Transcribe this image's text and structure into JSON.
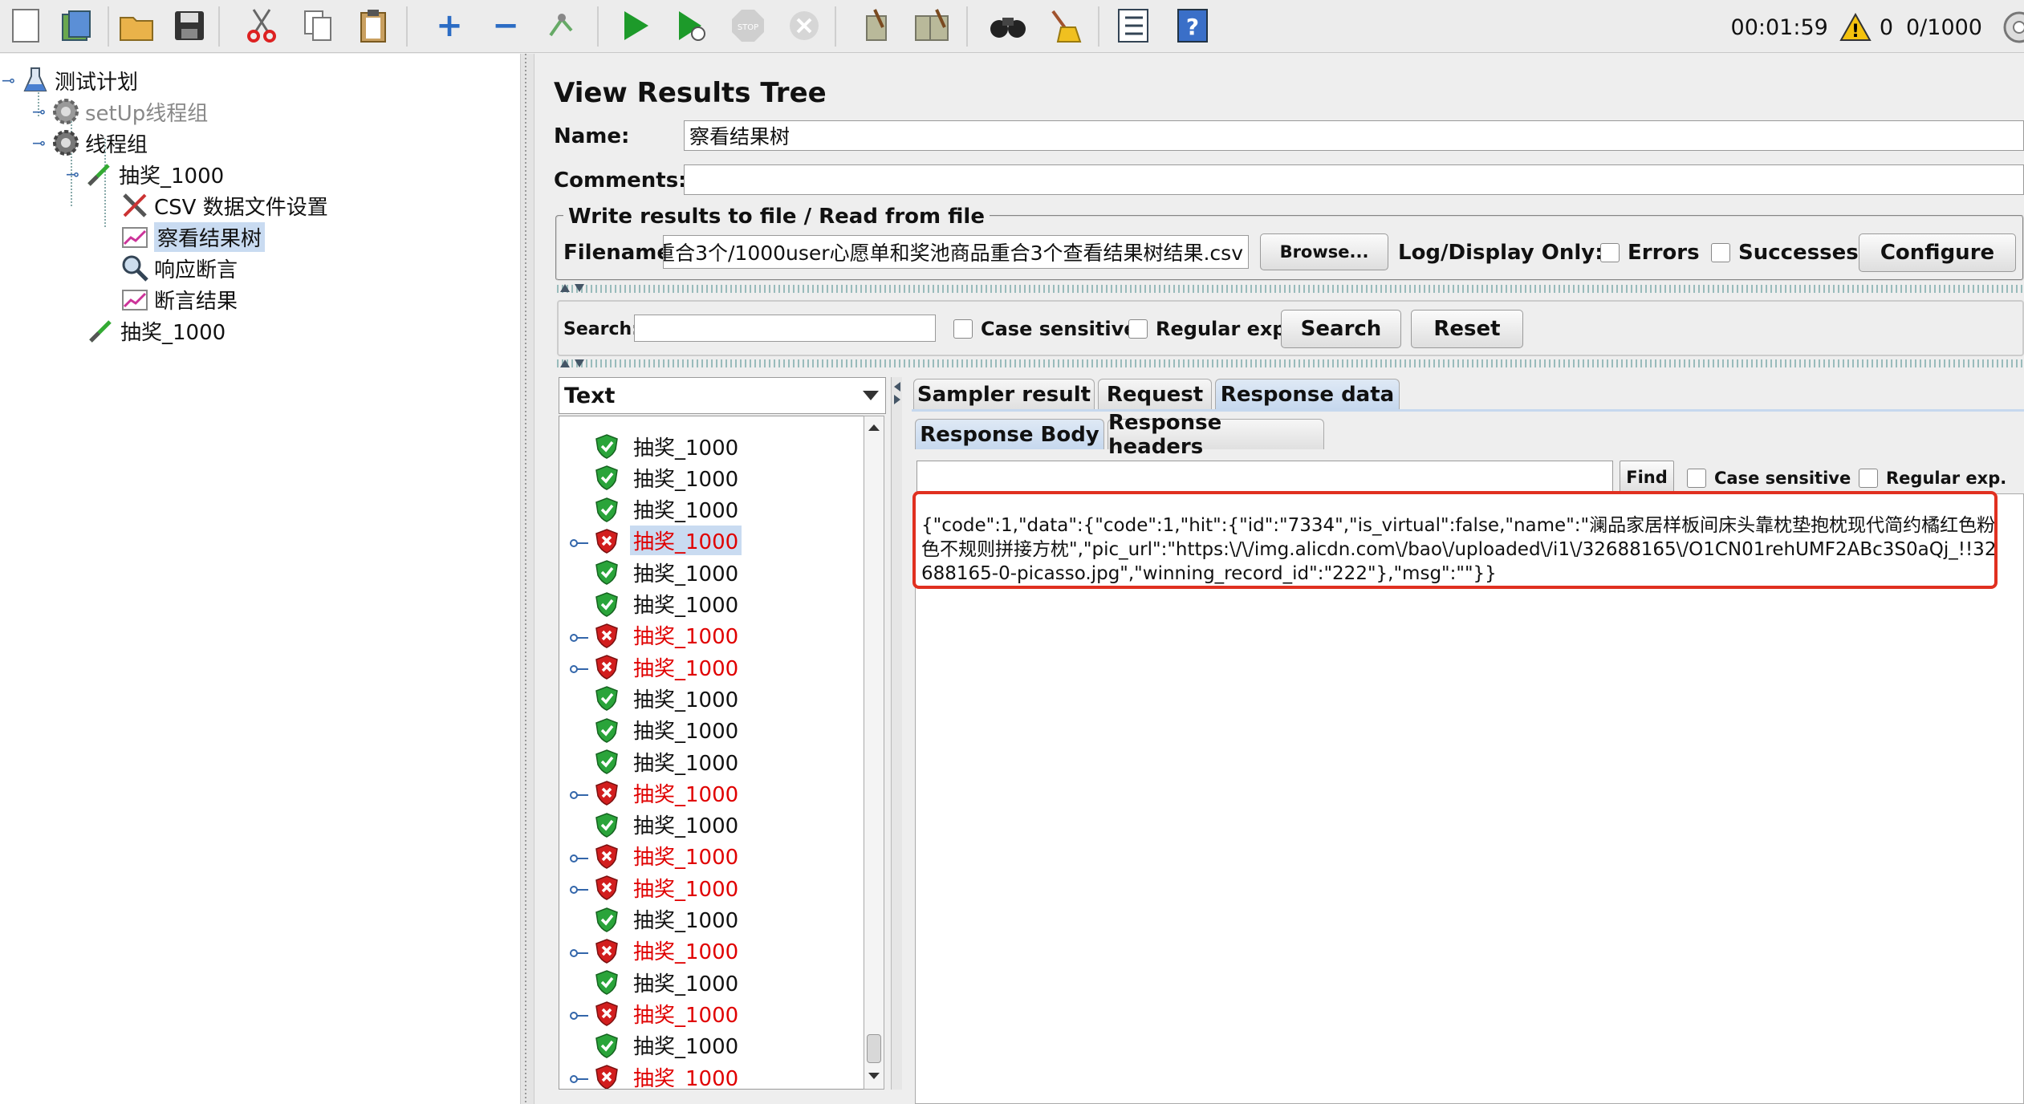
{
  "toolbar": {
    "icons": [
      "new-icon",
      "templates-icon",
      "open-icon",
      "save-icon",
      "cut-icon",
      "copy-icon",
      "paste-icon",
      "expand-icon",
      "collapse-icon",
      "toggle-icon",
      "start-icon",
      "start-no-pause-icon",
      "stop-icon",
      "shutdown-icon",
      "clear-icon",
      "clear-all-icon",
      "search-icon",
      "reset-search-icon",
      "function-helper-icon",
      "help-icon"
    ],
    "elapsed": "00:01:59",
    "warnings": "0",
    "threads": "0/1000"
  },
  "tree": {
    "nodes": [
      {
        "label": "测试计划",
        "icon": "test-plan-icon"
      },
      {
        "label": "setUp线程组",
        "icon": "gear-icon"
      },
      {
        "label": "线程组",
        "icon": "gear-icon"
      },
      {
        "label": "抽奖_1000",
        "icon": "sampler-icon"
      },
      {
        "label": "CSV 数据文件设置",
        "icon": "config-icon"
      },
      {
        "label": "察看结果树",
        "icon": "listener-icon"
      },
      {
        "label": "响应断言",
        "icon": "assertion-icon"
      },
      {
        "label": "断言结果",
        "icon": "listener-icon"
      },
      {
        "label": "抽奖_1000",
        "icon": "sampler-icon"
      }
    ]
  },
  "panel": {
    "title": "View Results Tree",
    "name_label": "Name:",
    "name_value": "察看结果树",
    "comments_label": "Comments:",
    "comments_value": "",
    "file_group_title": "Write results to file / Read from file",
    "filename_label": "Filename",
    "filename_value": "重合3个/1000user心愿单和奖池商品重合3个查看结果树结果.csv",
    "browse_label": "Browse...",
    "log_display_label": "Log/Display Only:",
    "errors_label": "Errors",
    "successes_label": "Successes",
    "configure_label": "Configure"
  },
  "search": {
    "label": "Search:",
    "value": "",
    "case_label": "Case sensitive",
    "regex_label": "Regular exp.",
    "search_button": "Search",
    "reset_button": "Reset"
  },
  "results": {
    "renderer": "Text",
    "items": [
      {
        "label": "抽奖_1000",
        "status": "ok"
      },
      {
        "label": "抽奖_1000",
        "status": "ok"
      },
      {
        "label": "抽奖_1000",
        "status": "ok"
      },
      {
        "label": "抽奖_1000",
        "status": "error",
        "selected": true
      },
      {
        "label": "抽奖_1000",
        "status": "ok"
      },
      {
        "label": "抽奖_1000",
        "status": "ok"
      },
      {
        "label": "抽奖_1000",
        "status": "error"
      },
      {
        "label": "抽奖_1000",
        "status": "error"
      },
      {
        "label": "抽奖_1000",
        "status": "ok"
      },
      {
        "label": "抽奖_1000",
        "status": "ok"
      },
      {
        "label": "抽奖_1000",
        "status": "ok"
      },
      {
        "label": "抽奖_1000",
        "status": "error"
      },
      {
        "label": "抽奖_1000",
        "status": "ok"
      },
      {
        "label": "抽奖_1000",
        "status": "error"
      },
      {
        "label": "抽奖_1000",
        "status": "error"
      },
      {
        "label": "抽奖_1000",
        "status": "ok"
      },
      {
        "label": "抽奖_1000",
        "status": "error"
      },
      {
        "label": "抽奖_1000",
        "status": "ok"
      },
      {
        "label": "抽奖_1000",
        "status": "error"
      },
      {
        "label": "抽奖_1000",
        "status": "ok"
      },
      {
        "label": "抽奖_1000",
        "status": "error"
      }
    ]
  },
  "tabs": {
    "sampler_result": "Sampler result",
    "request": "Request",
    "response_data": "Response data",
    "response_body": "Response Body",
    "response_headers": "Response headers",
    "find_label": "Find",
    "case_label": "Case sensitive",
    "regex_label": "Regular exp."
  },
  "response": {
    "body": "{\"code\":1,\"data\":{\"code\":1,\"hit\":{\"id\":\"7334\",\"is_virtual\":false,\"name\":\"澜品家居样板间床头靠枕垫抱枕现代简约橘红色粉色不规则拼接方枕\",\"pic_url\":\"https:\\/\\/img.alicdn.com\\/bao\\/uploaded\\/i1\\/32688165\\/O1CN01rehUMF2ABc3S0aQj_!!32688165-0-picasso.jpg\",\"winning_record_id\":\"222\"},\"msg\":\"\"}}"
  },
  "colors": {
    "error_text": "#e00000",
    "highlight": "#e03020",
    "selection": "#c9dbf1"
  }
}
